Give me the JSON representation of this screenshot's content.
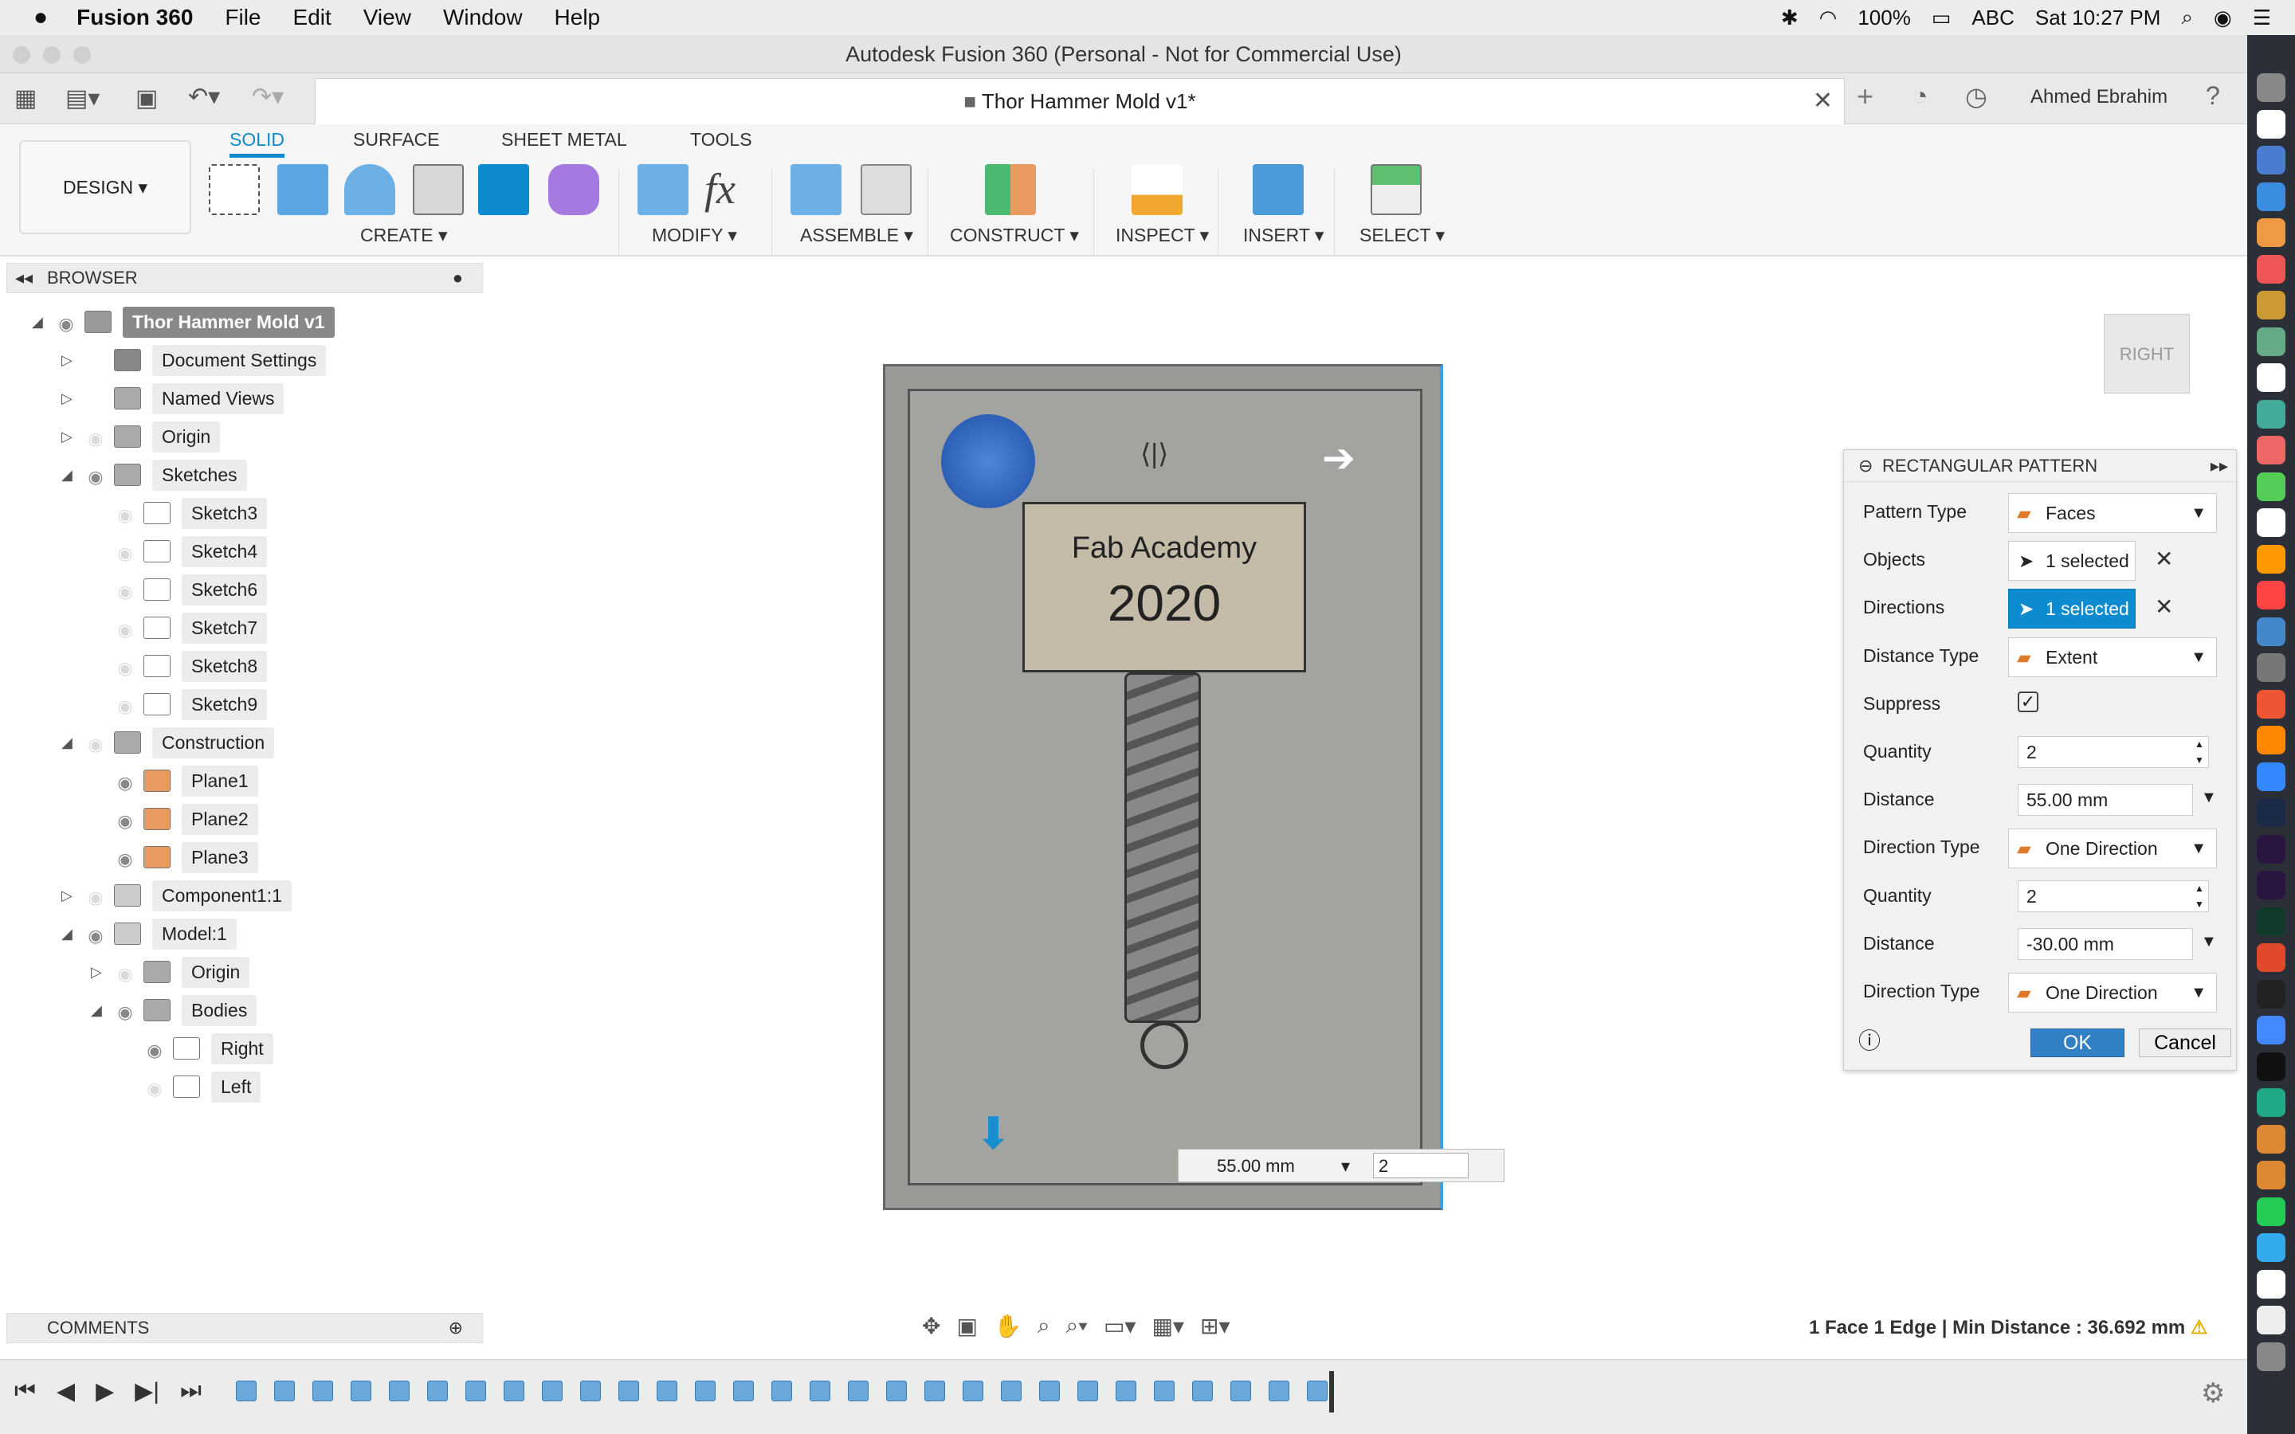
{
  "menubar": {
    "app": "Fusion 360",
    "items": [
      "File",
      "Edit",
      "View",
      "Window",
      "Help"
    ],
    "battery": "100%",
    "input": "ABC",
    "clock": "Sat 10:27 PM"
  },
  "window": {
    "title": "Autodesk Fusion 360 (Personal - Not for Commercial Use)",
    "doc_tab": "Thor Hammer Mold v1*",
    "user": "Ahmed Ebrahim"
  },
  "toolbar": {
    "workspace": "DESIGN ▾",
    "tabs": [
      "SOLID",
      "SURFACE",
      "SHEET METAL",
      "TOOLS"
    ],
    "groups": [
      "CREATE ▾",
      "MODIFY ▾",
      "ASSEMBLE ▾",
      "CONSTRUCT ▾",
      "INSPECT ▾",
      "INSERT ▾",
      "SELECT ▾"
    ]
  },
  "browser": {
    "title": "BROWSER",
    "items": [
      {
        "label": "Thor Hammer Mold v1",
        "level": 0,
        "tri": "◢",
        "eye": true,
        "icon": "document"
      },
      {
        "label": "Document Settings",
        "level": 1,
        "tri": "▷",
        "eye": null,
        "icon": "gear"
      },
      {
        "label": "Named Views",
        "level": 1,
        "tri": "▷",
        "eye": null,
        "icon": "folder"
      },
      {
        "label": "Origin",
        "level": 1,
        "tri": "▷",
        "eye": false,
        "icon": "folder"
      },
      {
        "label": "Sketches",
        "level": 1,
        "tri": "◢",
        "eye": true,
        "icon": "folder"
      },
      {
        "label": "Sketch3",
        "level": 2,
        "tri": "",
        "eye": false,
        "icon": "sketch"
      },
      {
        "label": "Sketch4",
        "level": 2,
        "tri": "",
        "eye": false,
        "icon": "sketch"
      },
      {
        "label": "Sketch6",
        "level": 2,
        "tri": "",
        "eye": false,
        "icon": "sketch"
      },
      {
        "label": "Sketch7",
        "level": 2,
        "tri": "",
        "eye": false,
        "icon": "sketch"
      },
      {
        "label": "Sketch8",
        "level": 2,
        "tri": "",
        "eye": false,
        "icon": "sketch"
      },
      {
        "label": "Sketch9",
        "level": 2,
        "tri": "",
        "eye": false,
        "icon": "sketch"
      },
      {
        "label": "Construction",
        "level": 1,
        "tri": "◢",
        "eye": false,
        "icon": "folder"
      },
      {
        "label": "Plane1",
        "level": 2,
        "tri": "",
        "eye": true,
        "icon": "plane"
      },
      {
        "label": "Plane2",
        "level": 2,
        "tri": "",
        "eye": true,
        "icon": "plane"
      },
      {
        "label": "Plane3",
        "level": 2,
        "tri": "",
        "eye": true,
        "icon": "plane"
      },
      {
        "label": "Component1:1",
        "level": 1,
        "tri": "▷",
        "eye": false,
        "icon": "component"
      },
      {
        "label": "Model:1",
        "level": 1,
        "tri": "◢",
        "eye": true,
        "icon": "component"
      },
      {
        "label": "Origin",
        "level": 2,
        "tri": "▷",
        "eye": false,
        "icon": "folder"
      },
      {
        "label": "Bodies",
        "level": 2,
        "tri": "◢",
        "eye": true,
        "icon": "folder"
      },
      {
        "label": "Right",
        "level": 3,
        "tri": "",
        "eye": true,
        "icon": "body"
      },
      {
        "label": "Left",
        "level": 3,
        "tri": "",
        "eye": false,
        "icon": "body"
      }
    ]
  },
  "viewport": {
    "model_text1": "Fab Academy",
    "model_text2": "2020",
    "viewcube": "RIGHT",
    "input_distance": "55.00 mm",
    "input_quantity": "2"
  },
  "panel": {
    "title": "RECTANGULAR PATTERN",
    "rows": [
      {
        "label": "Pattern Type",
        "value": "Faces",
        "kind": "dropdown"
      },
      {
        "label": "Objects",
        "value": "1 selected",
        "kind": "select"
      },
      {
        "label": "Directions",
        "value": "1 selected",
        "kind": "select-active"
      },
      {
        "label": "Distance Type",
        "value": "Extent",
        "kind": "dropdown"
      },
      {
        "label": "Suppress",
        "value": "✓",
        "kind": "checkbox"
      },
      {
        "label": "Quantity",
        "value": "2",
        "kind": "spinner"
      },
      {
        "label": "Distance",
        "value": "55.00 mm",
        "kind": "valuedd"
      },
      {
        "label": "Direction Type",
        "value": "One Direction",
        "kind": "dropdown"
      },
      {
        "label": "Quantity",
        "value": "2",
        "kind": "spinner"
      },
      {
        "label": "Distance",
        "value": "-30.00 mm",
        "kind": "valuedd"
      },
      {
        "label": "Direction Type",
        "value": "One Direction",
        "kind": "dropdown"
      }
    ],
    "ok": "OK",
    "cancel": "Cancel"
  },
  "comments": {
    "title": "COMMENTS"
  },
  "status": {
    "text": "1 Face 1 Edge | Min Distance : 36.692 mm",
    "accent": "#0d8bd0"
  }
}
